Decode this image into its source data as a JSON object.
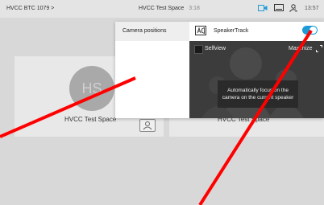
{
  "topbar": {
    "device_name": "HVCC BTC 1079",
    "chevron": ">",
    "meeting_name": "HVCC Test Space",
    "duration": "3:18",
    "time": "13:57",
    "icons": [
      "camera-icon",
      "screen-share-icon",
      "participants-icon"
    ],
    "accent": "#1c9bd6"
  },
  "tiles": [
    {
      "avatar": "HS",
      "name": "HVCC Test Space"
    },
    {
      "name": "HVCC Test Space"
    }
  ],
  "panel": {
    "tab_label": "Camera positions",
    "speakertrack_label": "SpeakerTrack",
    "speakertrack_on": true,
    "selfview_label": "Selfview",
    "maximize_label": "Maximize",
    "tooltip_line1": "Automatically focus on the",
    "tooltip_line2": "camera on the current speaker"
  },
  "annotation_color": "#ff0000"
}
